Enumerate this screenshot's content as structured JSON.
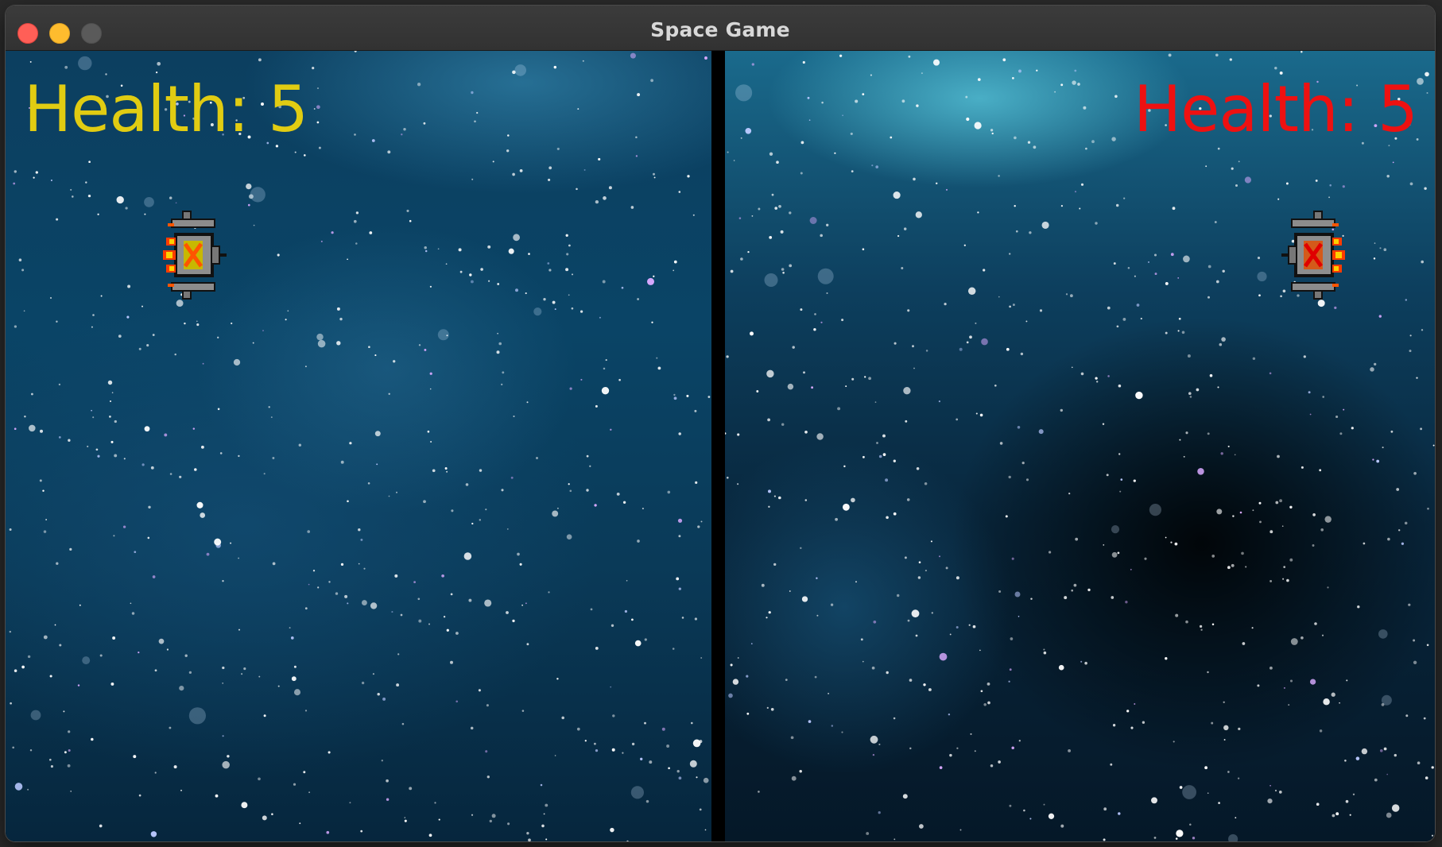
{
  "window": {
    "title": "Space Game",
    "buttons": [
      "close",
      "minimize",
      "maximize"
    ]
  },
  "game": {
    "player1": {
      "health_label": "Health: 5",
      "health": 5,
      "color": "#e1cc12",
      "ship_icon": "spaceship-yellow-icon"
    },
    "player2": {
      "health_label": "Health: 5",
      "health": 5,
      "color": "#ee1111",
      "ship_icon": "spaceship-red-icon"
    },
    "background": "starfield"
  }
}
